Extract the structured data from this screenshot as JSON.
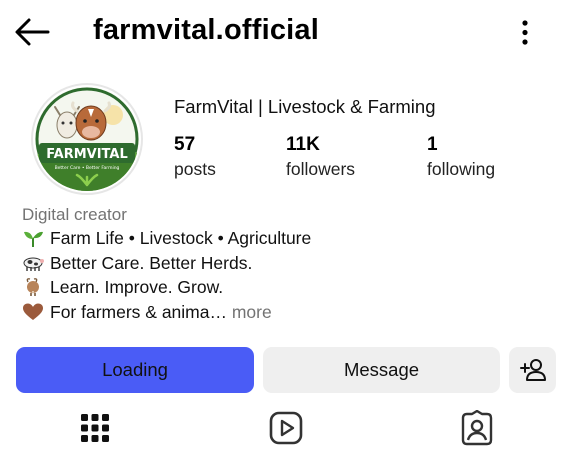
{
  "header": {
    "back_icon": "arrow-left-icon",
    "username": "farmvital.official",
    "menu_icon": "more-vertical-icon"
  },
  "profile": {
    "avatar_logo_text": "FARMVITAL",
    "avatar_logo_tagline": "Better Care • Better Farming",
    "display_name": "FarmVital | Livestock & Farming",
    "stats": [
      {
        "value": "57",
        "label": "posts"
      },
      {
        "value": "11K",
        "label": "followers"
      },
      {
        "value": "1",
        "label": "following"
      }
    ]
  },
  "bio": {
    "category": "Digital creator",
    "lines": [
      {
        "emoji": "seedling-icon",
        "text": "Farm Life • Livestock • Agriculture"
      },
      {
        "emoji": "cow-icon",
        "text": "Better Care. Better Herds."
      },
      {
        "emoji": "goat-icon",
        "text": "Learn. Improve. Grow."
      },
      {
        "emoji": "brown-heart-icon",
        "text": "For farmers & anima…"
      }
    ],
    "more_label": "more"
  },
  "actions": {
    "primary_label": "Loading",
    "message_label": "Message",
    "add_user_icon": "add-user-icon"
  },
  "tabs": [
    {
      "icon": "grid-icon"
    },
    {
      "icon": "reels-icon"
    },
    {
      "icon": "tagged-icon"
    }
  ],
  "colors": {
    "primary_button": "#4a5cf6",
    "secondary_button": "#efefef",
    "muted_text": "#737373",
    "logo_green": "#2e6b2e"
  }
}
